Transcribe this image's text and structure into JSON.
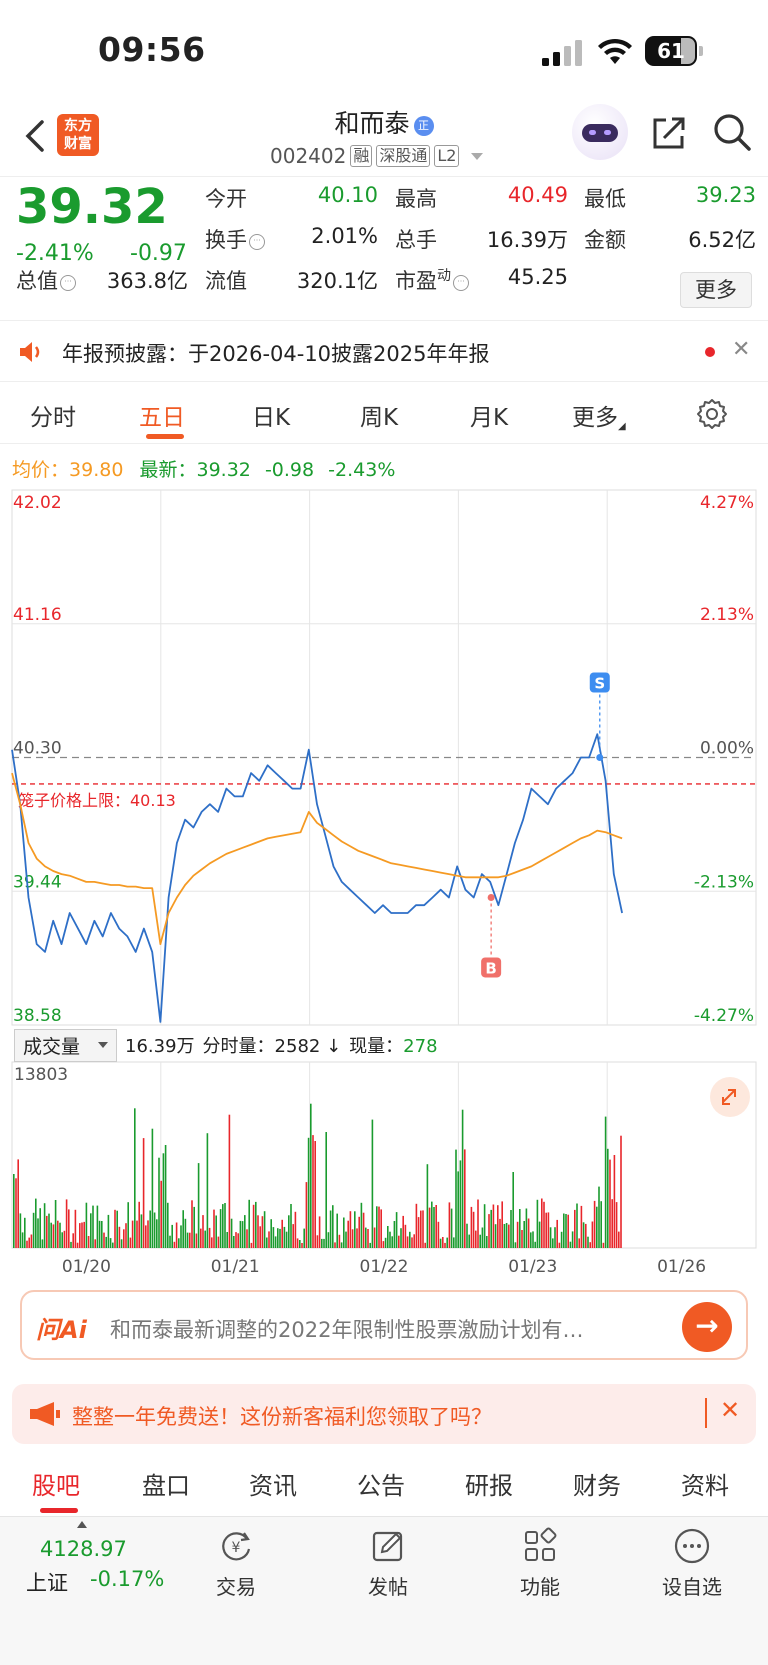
{
  "status": {
    "time": "09:56",
    "battery": "61"
  },
  "header": {
    "logo_line1": "东方",
    "logo_line2": "财富",
    "stock_name": "和而泰",
    "name_badge": "正",
    "stock_code": "002402",
    "tags": [
      "融",
      "深股通",
      "L2"
    ]
  },
  "quote": {
    "price": "39.32",
    "change_pct": "-2.41%",
    "change": "-0.97",
    "open_label": "今开",
    "open": "40.10",
    "high_label": "最高",
    "high": "40.49",
    "low_label": "最低",
    "low": "39.23",
    "turnover_label": "换手",
    "turnover": "2.01%",
    "volume_label": "总手",
    "volume": "16.39万",
    "amount_label": "金额",
    "amount": "6.52亿",
    "mktcap_label": "总值",
    "mktcap": "363.8亿",
    "float_label": "流值",
    "float": "320.1亿",
    "pe_label": "市盈",
    "pe_sup": "动",
    "pe": "45.25",
    "more_button": "更多"
  },
  "notice": {
    "text": "年报预披露：于2026-04-10披露2025年年报"
  },
  "tabs": [
    "分时",
    "五日",
    "日K",
    "周K",
    "月K",
    "更多"
  ],
  "avg_row": {
    "avg_label": "均价：",
    "avg": "39.80",
    "latest_label": "最新：",
    "latest": "39.32",
    "chg": "-0.98",
    "chg_pct": "-2.43%"
  },
  "chart_data": {
    "type": "line",
    "title": "",
    "x_labels": [
      "01/20",
      "01/21",
      "01/22",
      "01/23",
      "01/26"
    ],
    "y_ticks_left": [
      "42.02",
      "41.16",
      "40.30",
      "39.44",
      "38.58"
    ],
    "y_ticks_right": [
      "4.27%",
      "2.13%",
      "0.00%",
      "-2.13%",
      "-4.27%"
    ],
    "ylim": [
      38.58,
      42.02
    ],
    "prev_close": 40.3,
    "cage_limit_label": "笼子价格上限：40.13",
    "cage_limit": 40.13,
    "markers": [
      {
        "label": "S",
        "day": 3.95,
        "price": 40.3
      },
      {
        "label": "B",
        "day": 3.22,
        "price": 39.4
      }
    ],
    "series": [
      {
        "name": "价格",
        "color": "#2e6fc7",
        "values": [
          40.35,
          40.0,
          39.4,
          39.1,
          39.05,
          39.25,
          39.1,
          39.3,
          39.2,
          39.1,
          39.25,
          39.15,
          39.3,
          39.2,
          39.15,
          39.05,
          39.2,
          39.05,
          38.6,
          39.4,
          39.75,
          39.9,
          39.85,
          39.95,
          40.0,
          39.95,
          40.1,
          40.05,
          40.05,
          40.2,
          40.15,
          40.25,
          40.2,
          40.15,
          40.1,
          40.1,
          40.35,
          40.0,
          39.8,
          39.6,
          39.5,
          39.45,
          39.4,
          39.35,
          39.3,
          39.35,
          39.3,
          39.3,
          39.3,
          39.35,
          39.35,
          39.4,
          39.45,
          39.4,
          39.6,
          39.45,
          39.4,
          39.55,
          39.5,
          39.35,
          39.55,
          39.75,
          39.9,
          40.1,
          40.05,
          40.0,
          40.1,
          40.15,
          40.2,
          40.3,
          40.3,
          40.45,
          40.15,
          39.55,
          39.3
        ]
      },
      {
        "name": "均价",
        "color": "#f59a23",
        "values": [
          40.2,
          40.0,
          39.75,
          39.65,
          39.6,
          39.57,
          39.55,
          39.54,
          39.52,
          39.5,
          39.5,
          39.49,
          39.48,
          39.48,
          39.47,
          39.47,
          39.46,
          39.46,
          39.1,
          39.3,
          39.4,
          39.48,
          39.54,
          39.58,
          39.62,
          39.65,
          39.68,
          39.7,
          39.72,
          39.74,
          39.76,
          39.78,
          39.79,
          39.8,
          39.81,
          39.82,
          39.95,
          39.88,
          39.84,
          39.8,
          39.76,
          39.73,
          39.7,
          39.68,
          39.66,
          39.64,
          39.62,
          39.61,
          39.6,
          39.59,
          39.58,
          39.57,
          39.56,
          39.55,
          39.54,
          39.53,
          39.53,
          39.53,
          39.53,
          39.53,
          39.54,
          39.56,
          39.58,
          39.6,
          39.63,
          39.66,
          39.69,
          39.72,
          39.75,
          39.78,
          39.8,
          39.83,
          39.82,
          39.8,
          39.78
        ]
      }
    ],
    "volume": {
      "label": "成交量",
      "total": "16.39万",
      "minute_label": "分时量：",
      "minute": "2582",
      "now_label": "现量：",
      "now": "278",
      "y_max": "13803"
    }
  },
  "ai": {
    "logo": "问Ai",
    "text": "和而泰最新调整的2022年限制性股票激励计划有…"
  },
  "promo": {
    "text": "整整一年免费送！这份新客福利您领取了吗？"
  },
  "bottom_tabs": [
    "股吧",
    "盘口",
    "资讯",
    "公告",
    "研报",
    "财务",
    "资料"
  ],
  "nav": {
    "index_value": "4128.97",
    "index_name": "上证",
    "index_chg": "-0.17%",
    "items": [
      "交易",
      "发帖",
      "功能",
      "设自选"
    ]
  }
}
